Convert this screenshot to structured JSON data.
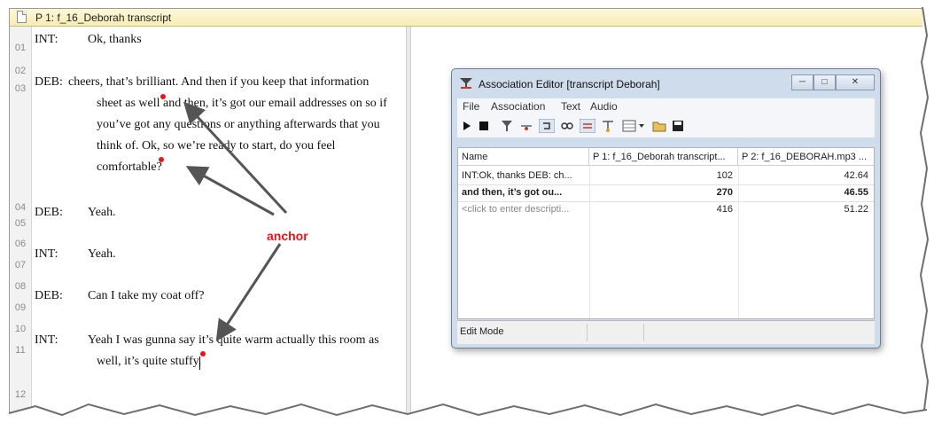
{
  "document": {
    "title": "P 1: f_16_Deborah transcript",
    "line_numbers": [
      "01",
      "02",
      "03",
      "04",
      "05",
      "06",
      "07",
      "08",
      "09",
      "10",
      "11",
      "12"
    ],
    "lines": {
      "l01_speaker": "INT:",
      "l01_text": "Ok, thanks",
      "l03_speaker": "DEB:",
      "l03_text1": "cheers,  that’s brilliant. And then if you keep that information",
      "l03_text2": "sheet as well and then, it’s got our email addresses on so if",
      "l03_text3": "you’ve got any questions or anything afterwards that you",
      "l03_text4": "think of. Ok, so we’re ready to start, do you feel",
      "l03_text5": "comfortable?",
      "l05_speaker": "DEB:",
      "l05_text": "Yeah.",
      "l07_speaker": "INT:",
      "l07_text": "Yeah.",
      "l09_speaker": "DEB:",
      "l09_text": "Can I take my coat off?",
      "l11_speaker": "INT:",
      "l11_text1": "Yeah I was gunna say it’s quite warm actually this room as",
      "l11_text2": "well, it’s quite stuffy."
    }
  },
  "annotation": {
    "label": "anchor",
    "color": "#e8141b"
  },
  "association_editor": {
    "title": "Association Editor [transcript Deborah]",
    "window_buttons": [
      "minimize",
      "maximize",
      "close"
    ],
    "menu": [
      "File",
      "Association",
      "Text",
      "Audio"
    ],
    "toolbar_icons": [
      "play-icon",
      "stop-icon",
      "associate-icon",
      "disassociate-icon",
      "link-icon",
      "chain-icon",
      "sync-icon",
      "split-icon",
      "view-icon",
      "dropdown-icon",
      "open-folder-icon",
      "save-icon"
    ],
    "columns": [
      "Name",
      "P 1: f_16_Deborah transcript...",
      "P 2: f_16_DEBORAH.mp3 ..."
    ],
    "rows": [
      {
        "name": "INT:Ok, thanks DEB: ch...",
        "p1": "102",
        "p2": "42.64",
        "bold": false
      },
      {
        "name": "and then, it’s got ou...",
        "p1": "270",
        "p2": "46.55",
        "bold": true
      },
      {
        "name": "<click to enter descripti...",
        "p1": "416",
        "p2": "51.22",
        "bold": false
      }
    ],
    "status": "Edit Mode"
  },
  "colors": {
    "title_bar": "#f6ecb4",
    "window_frame": "#cfdceb",
    "accent_red": "#e8141b"
  }
}
